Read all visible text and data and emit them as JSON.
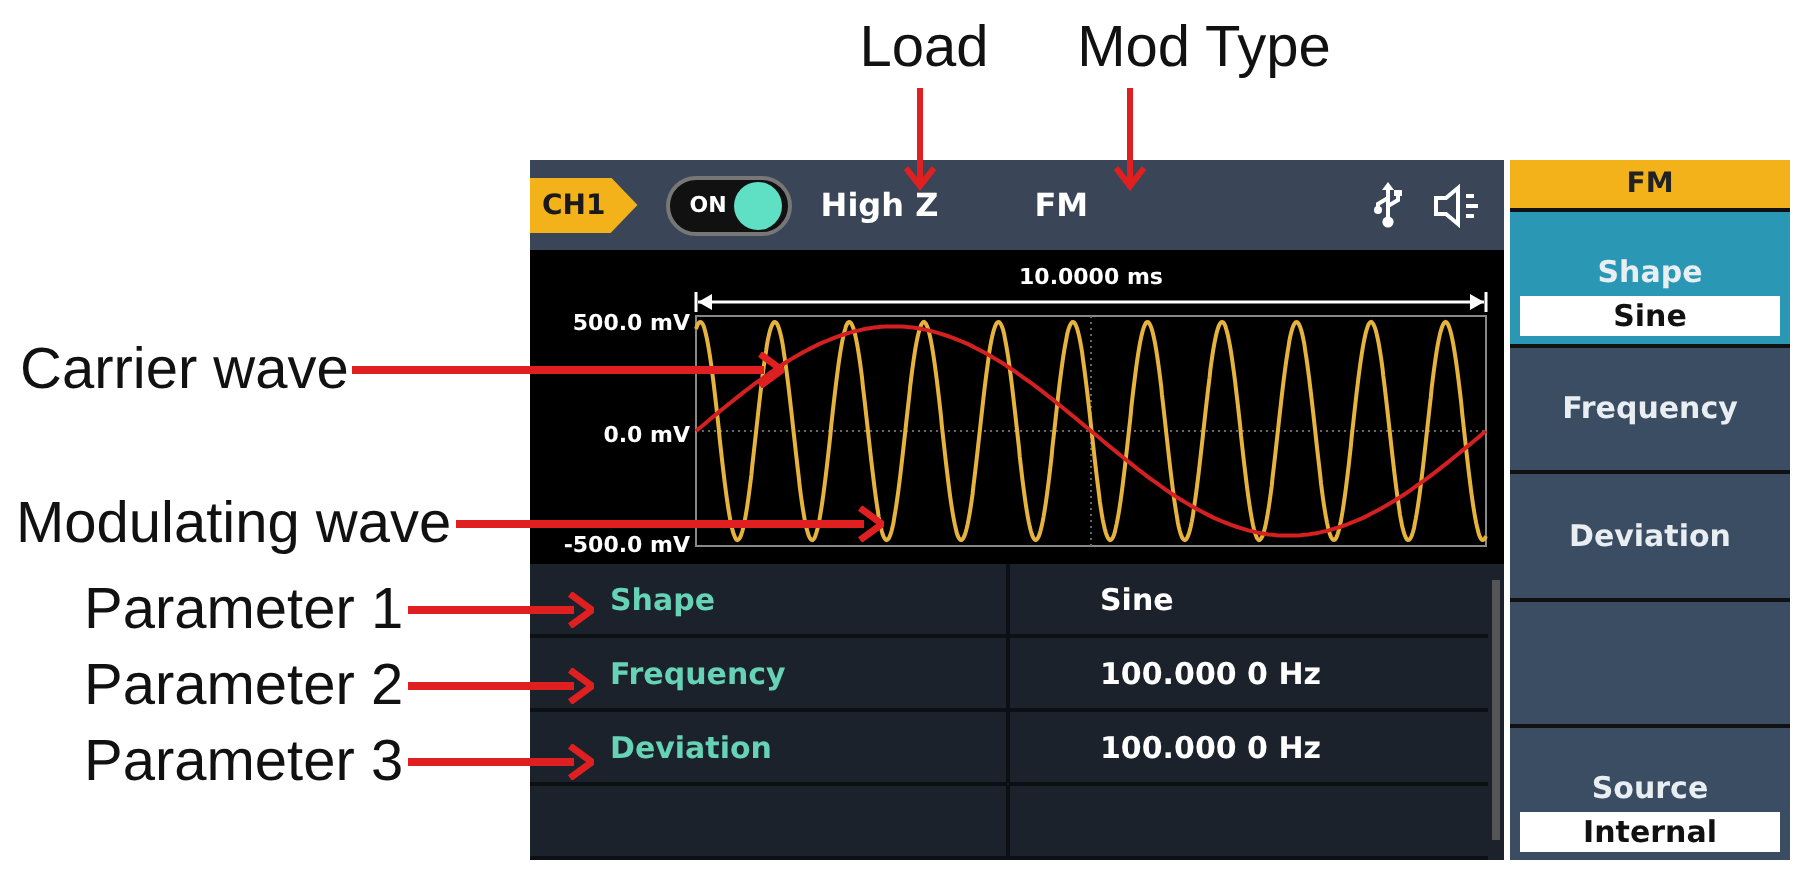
{
  "annotations": {
    "top": [
      {
        "text": "Load"
      },
      {
        "text": "Mod Type"
      }
    ],
    "left": [
      {
        "text": "Carrier wave"
      },
      {
        "text": "Modulating wave"
      },
      {
        "text": "Parameter 1"
      },
      {
        "text": "Parameter 2"
      },
      {
        "text": "Parameter 3"
      }
    ]
  },
  "header": {
    "channel": "CH1",
    "output": {
      "label": "ON",
      "on": true
    },
    "load": "High Z",
    "mod_type": "FM"
  },
  "waveform": {
    "timebase": "10.0000 ms",
    "y_labels": [
      "500.0 mV",
      "0.0 mV",
      "-500.0 mV"
    ]
  },
  "parameters": [
    {
      "name": "Shape",
      "value": "Sine"
    },
    {
      "name": "Frequency",
      "value": "100.000 0 Hz"
    },
    {
      "name": "Deviation",
      "value": "100.000 0 Hz"
    }
  ],
  "menu": {
    "title": "FM",
    "items": [
      {
        "kind": "select",
        "label": "Shape",
        "value": "Sine",
        "selected": true
      },
      {
        "kind": "plain",
        "label": "Frequency",
        "selected": false
      },
      {
        "kind": "plain",
        "label": "Deviation",
        "selected": false
      },
      {
        "kind": "empty",
        "selected": false
      },
      {
        "kind": "select",
        "label": "Source",
        "value": "Internal",
        "selected": false
      }
    ]
  }
}
